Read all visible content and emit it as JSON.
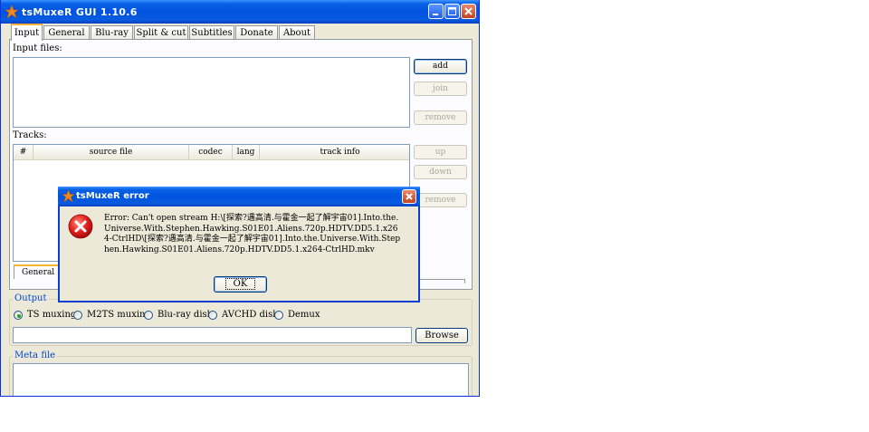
{
  "window": {
    "title": "tsMuxeR GUI 1.10.6",
    "colors": {
      "titlebar": "#0053e0",
      "face": "#ece9d8",
      "close": "#c3421f"
    }
  },
  "tabs": [
    {
      "label": "Input",
      "active": true
    },
    {
      "label": "General"
    },
    {
      "label": "Blu-ray"
    },
    {
      "label": "Split & cut"
    },
    {
      "label": "Subtitles"
    },
    {
      "label": "Donate"
    },
    {
      "label": "About"
    }
  ],
  "input": {
    "files_label": "Input files:",
    "add_label": "add",
    "join_label": "join",
    "remove_label": "remove"
  },
  "tracks": {
    "label": "Tracks:",
    "columns": [
      "#",
      "source file",
      "codec",
      "lang",
      "track info"
    ],
    "up_label": "up",
    "down_label": "down",
    "remove_label": "remove",
    "subtab_label": "General track options"
  },
  "output": {
    "title": "Output",
    "options": [
      "TS muxing",
      "M2TS muxing",
      "Blu-ray disk",
      "AVCHD disk",
      "Demux"
    ],
    "selected": "TS muxing",
    "path_value": "",
    "browse_label": "Browse"
  },
  "meta": {
    "title": "Meta file"
  },
  "dialog": {
    "title": "tsMuxeR error",
    "message": "Error: Can't open stream H:\\[探索?遇高清.与霍金一起了解宇宙01].Into.the.Universe.With.Stephen.Hawking.S01E01.Aliens.720p.HDTV.DD5.1.x264-CtrlHD\\[探索?遇高清.与霍金一起了解宇宙01].Into.the.Universe.With.Stephen.Hawking.S01E01.Aliens.720p.HDTV.DD5.1.x264-CtrlHD.mkv",
    "ok_label": "OK"
  }
}
